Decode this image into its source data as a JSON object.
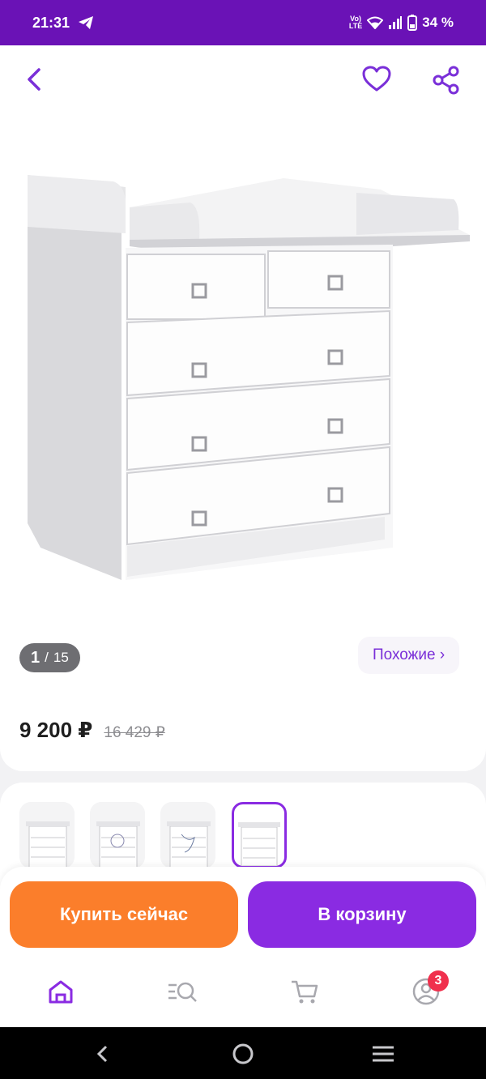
{
  "status_bar": {
    "time": "21:31",
    "battery": "34 %",
    "volte": "VoLTE",
    "icons": [
      "telegram-icon",
      "volte-icon",
      "wifi-icon",
      "signal-icon",
      "battery-icon"
    ]
  },
  "topbar": {
    "icons": [
      "chevron-left-icon",
      "heart-icon",
      "share-icon"
    ]
  },
  "gallery": {
    "current": "1",
    "separator": "/",
    "total": "15"
  },
  "similar_label": "Похожие ›",
  "price": {
    "current": "9 200 ₽",
    "old": "16 429 ₽"
  },
  "variants": {
    "count": 4,
    "selected_index": 3
  },
  "actions": {
    "buy_now": "Купить сейчас",
    "add_to_cart": "В корзину"
  },
  "bottom_nav": {
    "items": [
      "home-icon",
      "catalog-search-icon",
      "cart-icon",
      "profile-icon"
    ],
    "profile_badge": "3"
  },
  "colors": {
    "brand_purple": "#8a2be2",
    "status_bar": "#6a12b6",
    "buy_orange": "#fb7e2b",
    "badge_red": "#f0304d"
  }
}
